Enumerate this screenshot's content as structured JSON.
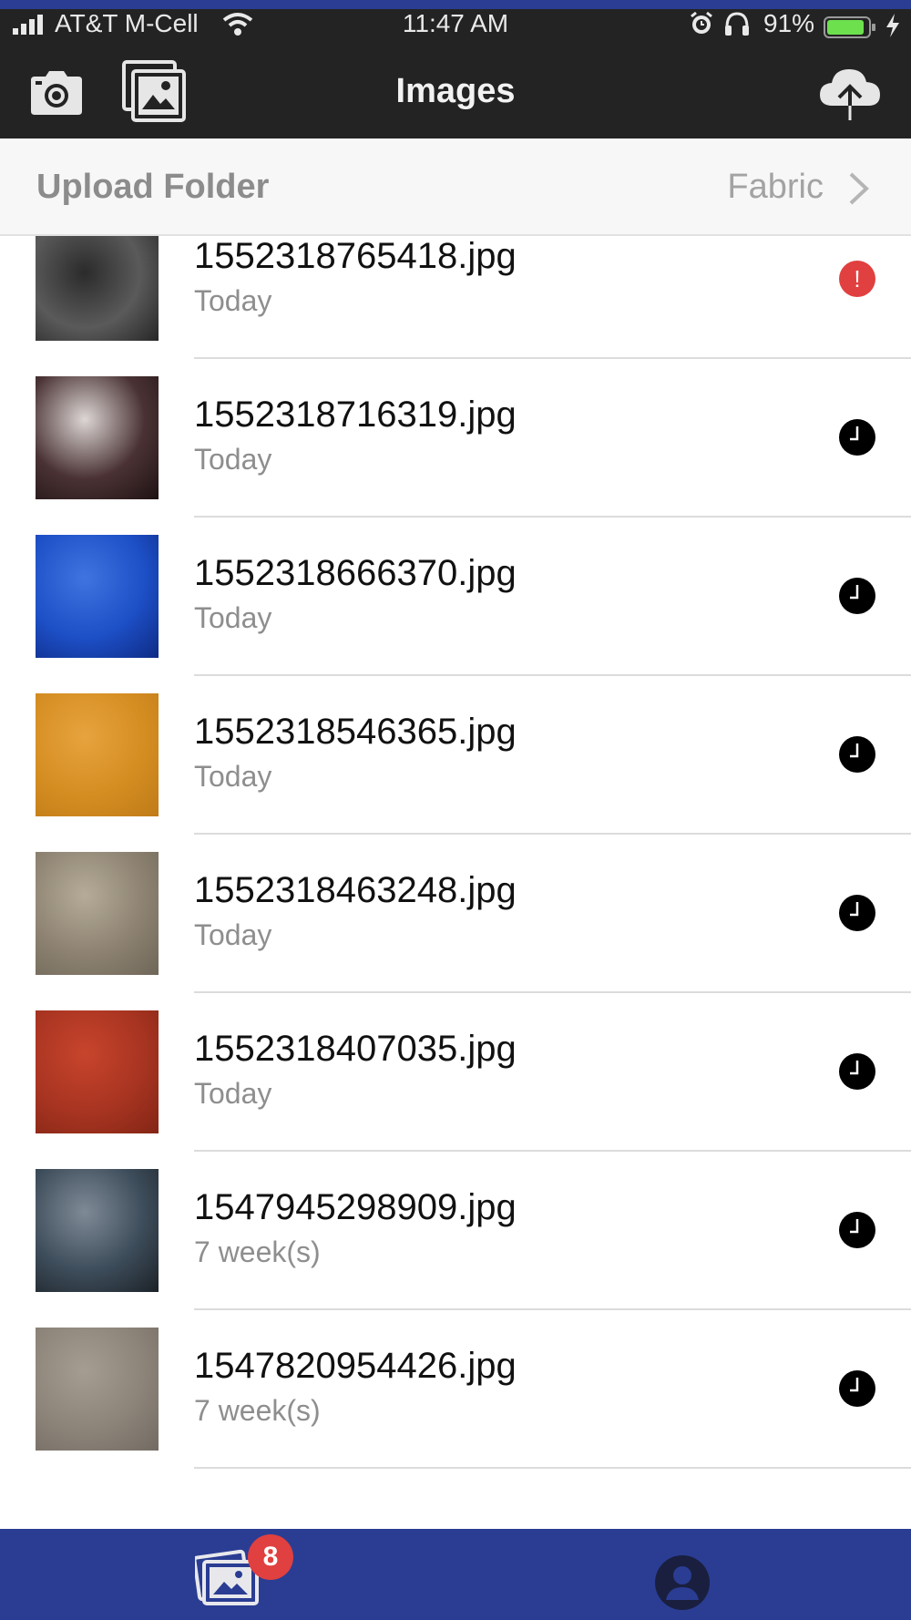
{
  "status_bar": {
    "carrier": "AT&T M-Cell",
    "time": "11:47 AM",
    "battery_percent": "91%",
    "battery_level": 0.91,
    "icons": [
      "signal-icon",
      "wifi-icon",
      "alarm-icon",
      "headphones-icon",
      "battery-icon",
      "charging-bolt-icon"
    ]
  },
  "nav": {
    "title": "Images",
    "left_icons": [
      "camera-icon",
      "photo-gallery-icon"
    ],
    "right_icon": "cloud-upload-icon"
  },
  "upload_folder": {
    "label": "Upload Folder",
    "value": "Fabric",
    "icon": "chevron-right-icon"
  },
  "files": [
    {
      "name": "1552318765418.jpg",
      "date": "Today",
      "status": "error",
      "status_glyph": "!",
      "thumb_colors": [
        "#2b2b2b",
        "#5a5a5a",
        "#262626"
      ]
    },
    {
      "name": "1552318716319.jpg",
      "date": "Today",
      "status": "pending",
      "thumb_colors": [
        "#dcd6d4",
        "#4a3234",
        "#1f1213"
      ]
    },
    {
      "name": "1552318666370.jpg",
      "date": "Today",
      "status": "pending",
      "thumb_colors": [
        "#3f74e0",
        "#1d4fc6",
        "#0e2b85"
      ]
    },
    {
      "name": "1552318546365.jpg",
      "date": "Today",
      "status": "pending",
      "thumb_colors": [
        "#e7a33e",
        "#d48d21",
        "#c07b18"
      ]
    },
    {
      "name": "1552318463248.jpg",
      "date": "Today",
      "status": "pending",
      "thumb_colors": [
        "#b5ab98",
        "#8d8271",
        "#6e6658"
      ]
    },
    {
      "name": "1552318407035.jpg",
      "date": "Today",
      "status": "pending",
      "thumb_colors": [
        "#c8442c",
        "#a73421",
        "#842515"
      ]
    },
    {
      "name": "1547945298909.jpg",
      "date": "7 week(s)",
      "status": "pending",
      "thumb_colors": [
        "#7f8a96",
        "#3d4c5a",
        "#1c2228"
      ]
    },
    {
      "name": "1547820954426.jpg",
      "date": "7 week(s)",
      "status": "pending",
      "thumb_colors": [
        "#a59c92",
        "#8c8379",
        "#736b62"
      ]
    }
  ],
  "tab_bar": {
    "gallery_icon": "photo-gallery-icon",
    "badge_count": "8",
    "profile_icon": "profile-icon"
  },
  "colors": {
    "header_bg": "#232323",
    "accent_blue": "#2a3d93",
    "error_red": "#e0403f",
    "pending_black": "#000000"
  }
}
